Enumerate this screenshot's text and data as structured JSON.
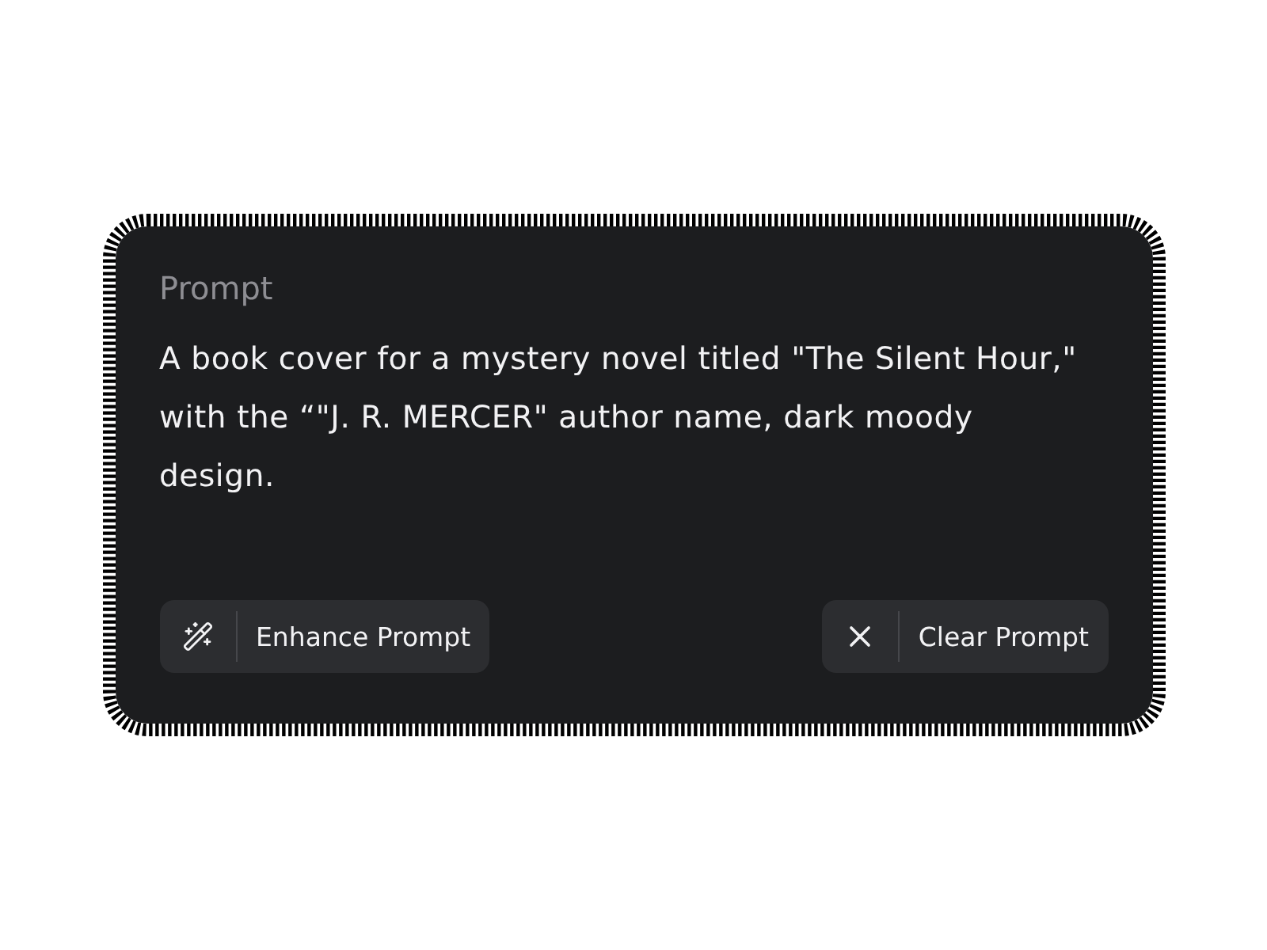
{
  "prompt": {
    "label": "Prompt",
    "text": "A book cover for a mystery novel titled \"The Silent Hour,\" with the “\"J. R. MERCER\" author name, dark moody design."
  },
  "actions": [
    {
      "kind": "enhance",
      "label": "Enhance Prompt"
    },
    {
      "kind": "clear",
      "label": "Clear Prompt"
    }
  ]
}
